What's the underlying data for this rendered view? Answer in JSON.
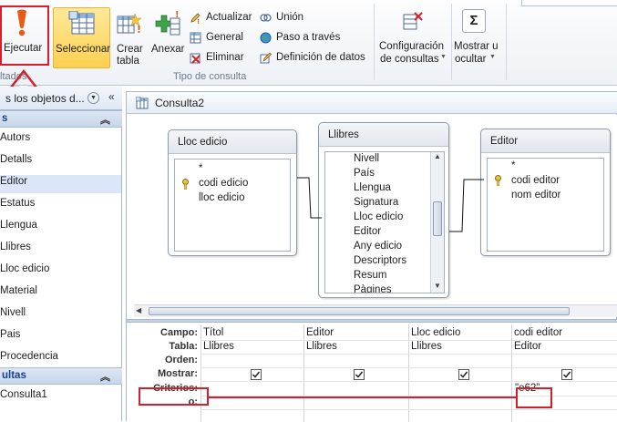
{
  "ribbon": {
    "results_group": "ltados",
    "run_label": "Ejecutar",
    "select_label": "Seleccionar",
    "make_table_line1": "Crear",
    "make_table_line2": "tabla",
    "append_label": "Anexar",
    "update_label": "Actualizar",
    "general_label": "General",
    "delete_label": "Eliminar",
    "union_label": "Unión",
    "passthrough_label": "Paso a través",
    "datadef_label": "Definición de datos",
    "query_type_group": "Tipo de consulta",
    "setup_line1": "Configuración",
    "setup_line2": "de consultas",
    "showhide_line1": "Mostrar u",
    "showhide_line2": "ocultar",
    "sigma": "Σ"
  },
  "nav": {
    "header": "s los objetos d...",
    "tables_header": "s",
    "tables": [
      "Autors",
      "Detalls",
      "Editor",
      "Estatus",
      "Llengua",
      "Llibres",
      "Lloc edicio",
      "Material",
      "Nivell",
      "Pais",
      "Procedencia"
    ],
    "queries_header": "ultas",
    "queries": [
      "Consulta1"
    ]
  },
  "query": {
    "title": "Consulta2",
    "tables": [
      {
        "name": "Lloc edicio",
        "fields": [
          "*",
          "codi edicio",
          "lloc edicio"
        ]
      },
      {
        "name": "Llibres",
        "fields": [
          "Nivell",
          "País",
          "Llengua",
          "Signatura",
          "Lloc edicio",
          "Editor",
          "Any edicio",
          "Descriptors",
          "Resum",
          "Pàgines"
        ]
      },
      {
        "name": "Editor",
        "fields": [
          "*",
          "codi editor",
          "nom editor"
        ]
      }
    ]
  },
  "grid": {
    "row_labels": [
      "Campo:",
      "Tabla:",
      "Orden:",
      "Mostrar:",
      "Criterios:",
      "o:"
    ],
    "columns": [
      {
        "campo": "Títol",
        "tabla": "Llibres",
        "mostrar": true,
        "criterios": ""
      },
      {
        "campo": "Editor",
        "tabla": "Llibres",
        "mostrar": true,
        "criterios": ""
      },
      {
        "campo": "Lloc edicio",
        "tabla": "Llibres",
        "mostrar": true,
        "criterios": ""
      },
      {
        "campo": "codi editor",
        "tabla": "Editor",
        "mostrar": true,
        "criterios": "\"e62\""
      }
    ]
  },
  "colors": {
    "highlight": "#d3202a",
    "selected_nav": "#dbe7f8",
    "run_icon": "#e8520f"
  }
}
